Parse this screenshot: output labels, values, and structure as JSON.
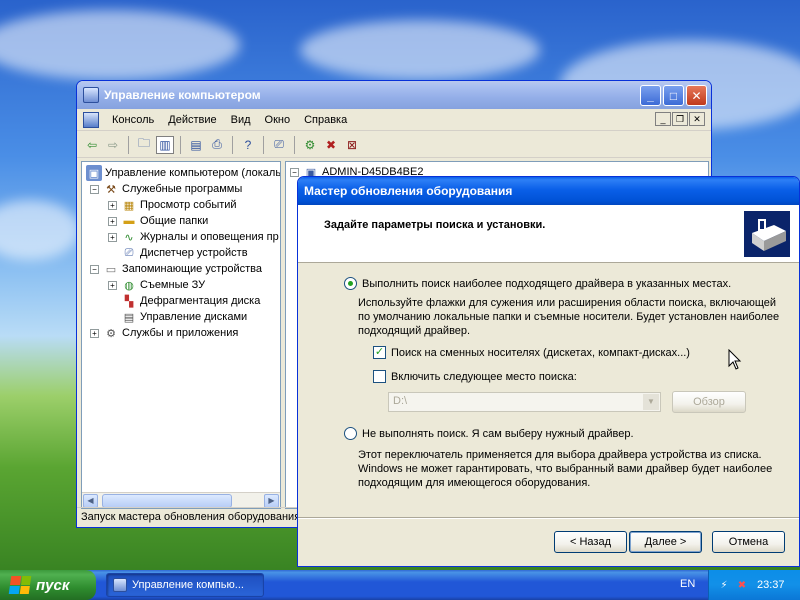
{
  "mmc": {
    "title": "Управление компьютером",
    "menu": [
      "Консоль",
      "Действие",
      "Вид",
      "Окно",
      "Справка"
    ],
    "tree": [
      {
        "label": "Управление компьютером (локаль",
        "icon": "computer-management-icon",
        "expander": "",
        "level": 0
      },
      {
        "label": "Служебные программы",
        "icon": "tools-icon",
        "expander": "−",
        "level": 1
      },
      {
        "label": "Просмотр событий",
        "icon": "event-viewer-icon",
        "expander": "+",
        "level": 2
      },
      {
        "label": "Общие папки",
        "icon": "shared-folder-icon",
        "expander": "+",
        "level": 2
      },
      {
        "label": "Журналы и оповещения пр",
        "icon": "performance-logs-icon",
        "expander": "+",
        "level": 2
      },
      {
        "label": "Диспетчер устройств",
        "icon": "device-manager-icon",
        "expander": "",
        "level": 2
      },
      {
        "label": "Запоминающие устройства",
        "icon": "storage-icon",
        "expander": "−",
        "level": 1
      },
      {
        "label": "Съемные ЗУ",
        "icon": "removable-storage-icon",
        "expander": "+",
        "level": 2
      },
      {
        "label": "Дефрагментация диска",
        "icon": "defrag-icon",
        "expander": "",
        "level": 2
      },
      {
        "label": "Управление дисками",
        "icon": "disk-management-icon",
        "expander": "",
        "level": 2
      },
      {
        "label": "Службы и приложения",
        "icon": "services-icon",
        "expander": "+",
        "level": 1
      }
    ],
    "right_root": "ADMIN-D45DB4BE2",
    "status": "Запуск мастера обновления оборудования"
  },
  "wizard": {
    "title": "Мастер обновления оборудования",
    "header": "Задайте параметры поиска и установки.",
    "option1": {
      "label": "Выполнить поиск наиболее подходящего драйвера в указанных местах.",
      "selected": true,
      "desc": "Используйте флажки для сужения или расширения области поиска, включающей по умолчанию локальные папки и съемные носители. Будет установлен наиболее подходящий драйвер."
    },
    "check1": {
      "label": "Поиск на сменных носителях (дискетах, компакт-дисках...)",
      "checked": true
    },
    "check2": {
      "label": "Включить следующее место поиска:",
      "checked": false
    },
    "path_value": "D:\\",
    "browse_label": "Обзор",
    "option2": {
      "label": "Не выполнять поиск. Я сам выберу нужный драйвер.",
      "selected": false,
      "desc": "Этот переключатель применяется для выбора драйвера устройства из списка. Windows не может гарантировать, что выбранный вами драйвер будет наиболее подходящим для имеющегося оборудования."
    },
    "back_label": "< Назад",
    "next_label": "Далее >",
    "cancel_label": "Отмена"
  },
  "taskbar": {
    "start_label": "пуск",
    "task_label": "Управление компью...",
    "lang": "EN",
    "clock": "23:37"
  }
}
